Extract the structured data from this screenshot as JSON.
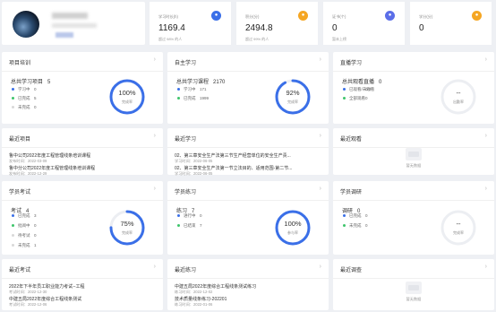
{
  "colors": {
    "blue": "#3a6fe8",
    "green": "#3ec56b",
    "orange": "#f5a623",
    "indigo": "#5b6ee8",
    "grey": "#d8d8d8"
  },
  "stats": [
    {
      "label": "学习时长(h)",
      "value": "1169.4",
      "sub": "超过 98% 的人",
      "icon": "clock-icon",
      "color": "#3a6fe8"
    },
    {
      "label": "积分(分)",
      "value": "2494.8",
      "sub": "超过 99% 的人",
      "icon": "coin-icon",
      "color": "#f5a623"
    },
    {
      "label": "证书(个)",
      "value": "0",
      "sub": "暂未上榜",
      "icon": "certificate-icon",
      "color": "#5b6ee8"
    },
    {
      "label": "学分(分)",
      "value": "0",
      "sub": "",
      "icon": "credit-icon",
      "color": "#f5a623"
    }
  ],
  "project": {
    "title": "项目培训",
    "total_label": "总共学习项目",
    "total": "5",
    "legend": [
      {
        "label": "学习中",
        "value": "0"
      },
      {
        "label": "已完成",
        "value": "5"
      },
      {
        "label": "未完成",
        "value": "0"
      }
    ],
    "percent": "100%",
    "ring_label": "完成率",
    "progress": 1.0
  },
  "self": {
    "title": "自主学习",
    "total_label": "总共学习课程",
    "total": "2170",
    "legend": [
      {
        "label": "学习中",
        "value": "171"
      },
      {
        "label": "已完成",
        "value": "1999"
      }
    ],
    "percent": "92%",
    "ring_label": "完成率",
    "progress": 0.92
  },
  "live": {
    "title": "直播学习",
    "total_label": "总共观看直播",
    "total": "0",
    "legend": [
      {
        "label": "已观看/未观看",
        "value": "0/0"
      },
      {
        "label": "全部观看",
        "value": "0"
      }
    ],
    "percent": "--",
    "ring_label": "出勤率",
    "progress": 0
  },
  "recent_project": {
    "title": "最近项目",
    "items": [
      {
        "name": "鲁中公司2022年度工程管理线条培训课程",
        "date": "发布时间：2022-03-09"
      },
      {
        "name": "鲁中分公司2022年度工程管理线条培训课程",
        "date": "发布时间：2022-12-29"
      }
    ]
  },
  "recent_study": {
    "title": "最近学习",
    "items": [
      {
        "name": "02、第三章安全生产法第三节生产经营单位的安全生产责...",
        "date": "学习时间：2022-06-05"
      },
      {
        "name": "02、第三章安全生产法第一节立法目的、适用范围-第二节...",
        "date": "学习时间：2022-06-05"
      }
    ]
  },
  "recent_watch": {
    "title": "最近观看",
    "empty": "暂无数据"
  },
  "exam": {
    "title": "学员考试",
    "total_label": "考试",
    "total": "4",
    "legend": [
      {
        "label": "已完成",
        "value": "3"
      },
      {
        "label": "批阅中",
        "value": "0"
      },
      {
        "label": "待考试",
        "value": "0"
      },
      {
        "label": "未完成",
        "value": "1"
      }
    ],
    "percent": "75%",
    "ring_label": "完成率",
    "progress": 0.75
  },
  "practice": {
    "title": "学员练习",
    "total_label": "练习",
    "total": "7",
    "legend": [
      {
        "label": "进行中",
        "value": "0"
      },
      {
        "label": "已结束",
        "value": "7"
      }
    ],
    "percent": "100%",
    "ring_label": "参与率",
    "progress": 1.0
  },
  "survey": {
    "title": "学员调研",
    "total_label": "调研",
    "total": "0",
    "legend": [
      {
        "label": "已完成",
        "value": "0"
      },
      {
        "label": "未完成",
        "value": "0"
      }
    ],
    "percent": "--",
    "ring_label": "完成率",
    "progress": 0
  },
  "recent_exam": {
    "title": "最近考试",
    "items": [
      {
        "name": "2022年下半年员工职业能力考试--工程",
        "date": "考试时间：2022-12-30"
      },
      {
        "name": "中建五局2022年度综合工程线条测试",
        "date": "考试时间：2022-12-06"
      }
    ]
  },
  "recent_practice": {
    "title": "最近练习",
    "items": [
      {
        "name": "中建五局2022年度综合工程线条测试练习",
        "date": "练习时间：2022-12-02"
      },
      {
        "name": "技术质量线条练习-202201",
        "date": "练习时间：2022-01-06"
      }
    ]
  },
  "recent_survey": {
    "title": "最近调查",
    "empty": "暂无数据"
  }
}
